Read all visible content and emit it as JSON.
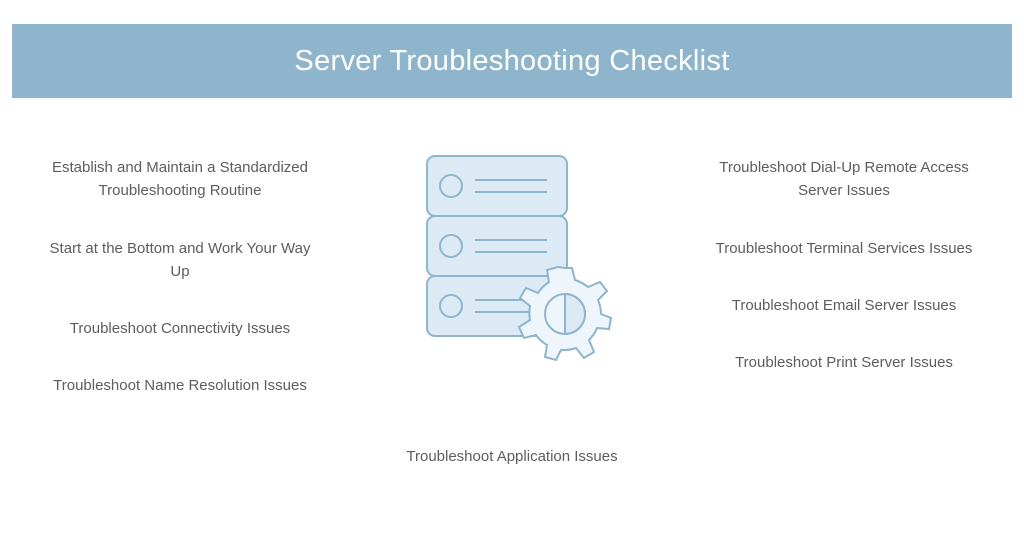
{
  "banner": {
    "title": "Server Troubleshooting Checklist"
  },
  "left_items": [
    "Establish and Maintain a Standardized Troubleshooting Routine",
    "Start at the Bottom and Work Your Way Up",
    "Troubleshoot Connectivity Issues",
    "Troubleshoot Name Resolution Issues"
  ],
  "right_items": [
    "Troubleshoot Dial-Up Remote Access Server Issues",
    "Troubleshoot Terminal Services Issues",
    "Troubleshoot Email Server Issues",
    "Troubleshoot Print Server Issues"
  ],
  "bottom_item": "Troubleshoot Application Issues",
  "colors": {
    "banner_bg": "#8fb5cd",
    "server_fill": "#dbeaf5",
    "server_stroke": "#8fb5cd",
    "gear_fill": "#eef5fb"
  }
}
